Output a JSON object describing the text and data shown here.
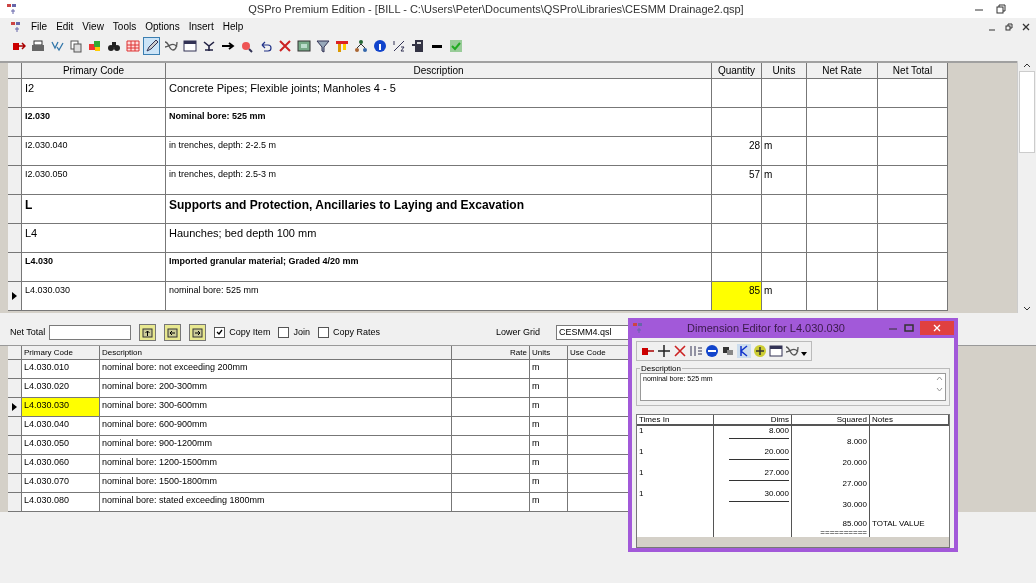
{
  "window": {
    "title": "QSPro Premium Edition - [BILL - C:\\Users\\Peter\\Documents\\QSPro\\Libraries\\CESMM Drainage2.qsp]"
  },
  "menu": [
    "File",
    "Edit",
    "View",
    "Tools",
    "Options",
    "Insert",
    "Help"
  ],
  "toolbar_buttons": [
    {
      "pressed": false
    },
    {
      "pressed": false
    },
    {
      "pressed": false
    },
    {
      "pressed": false
    },
    {
      "pressed": false
    },
    {
      "pressed": false
    },
    {
      "pressed": false
    },
    {
      "pressed": true
    },
    {
      "pressed": false
    },
    {
      "pressed": false
    },
    {
      "pressed": false
    },
    {
      "pressed": false
    },
    {
      "pressed": false
    },
    {
      "pressed": false
    },
    {
      "pressed": false
    },
    {
      "pressed": false
    },
    {
      "pressed": false
    },
    {
      "pressed": false
    },
    {
      "pressed": false
    },
    {
      "pressed": false
    },
    {
      "pressed": false
    },
    {
      "pressed": false
    },
    {
      "pressed": false
    },
    {
      "pressed": false
    }
  ],
  "upper_grid": {
    "columns": [
      "Primary Code",
      "Description",
      "Quantity",
      "Units",
      "Net Rate",
      "Net Total"
    ],
    "rows": [
      {
        "kind": "class",
        "code": "I2",
        "description": "Concrete Pipes; Flexible joints; Manholes 4 - 5",
        "quantity": "",
        "units": "",
        "selected": false
      },
      {
        "kind": "group",
        "code": "I2.030",
        "description": "Nominal bore: 525 mm",
        "quantity": "",
        "units": "",
        "selected": false
      },
      {
        "kind": "item",
        "code": "I2.030.040",
        "description": "in trenches, depth: 2-2.5 m",
        "quantity": "28",
        "units": "m",
        "selected": false
      },
      {
        "kind": "item",
        "code": "I2.030.050",
        "description": "in trenches, depth: 2.5-3 m",
        "quantity": "57",
        "units": "m",
        "selected": false
      },
      {
        "kind": "chapter",
        "code": "L",
        "description": "Supports and Protection, Ancillaries to Laying and Excavation",
        "quantity": "",
        "units": "",
        "selected": false
      },
      {
        "kind": "class",
        "code": "L4",
        "description": "Haunches; bed depth 100 mm",
        "quantity": "",
        "units": "",
        "selected": false
      },
      {
        "kind": "group",
        "code": "L4.030",
        "description": "Imported granular material; Graded 4/20 mm",
        "quantity": "",
        "units": "",
        "selected": false
      },
      {
        "kind": "item",
        "code": "L4.030.030",
        "description": "nominal bore: 525 mm",
        "quantity": "85",
        "units": "m",
        "selected": true
      }
    ]
  },
  "lower_bar": {
    "net_total_label": "Net Total",
    "checks": [
      {
        "label": "Copy Item",
        "checked": true
      },
      {
        "label": "Join",
        "checked": false
      },
      {
        "label": "Copy Rates",
        "checked": false
      }
    ],
    "lower_grid_label": "Lower Grid",
    "lower_grid": "CESMM4.qsl"
  },
  "lower_grid": {
    "columns": [
      "Primary Code",
      "Description",
      "Rate",
      "Units",
      "Use Code"
    ],
    "rows": [
      {
        "code": "L4.030.010",
        "description": "nominal bore: not exceeding 200mm",
        "units": "m",
        "selected": false
      },
      {
        "code": "L4.030.020",
        "description": "nominal bore: 200-300mm",
        "units": "m",
        "selected": false
      },
      {
        "code": "L4.030.030",
        "description": "nominal bore: 300-600mm",
        "units": "m",
        "selected": true
      },
      {
        "code": "L4.030.040",
        "description": "nominal bore: 600-900mm",
        "units": "m",
        "selected": false
      },
      {
        "code": "L4.030.050",
        "description": "nominal bore: 900-1200mm",
        "units": "m",
        "selected": false
      },
      {
        "code": "L4.030.060",
        "description": "nominal bore: 1200-1500mm",
        "units": "m",
        "selected": false
      },
      {
        "code": "L4.030.070",
        "description": "nominal bore: 1500-1800mm",
        "units": "m",
        "selected": false
      },
      {
        "code": "L4.030.080",
        "description": "nominal bore: stated exceeding 1800mm",
        "units": "m",
        "selected": false
      }
    ]
  },
  "dimension_editor": {
    "title": "Dimension Editor for L4.030.030",
    "description_label": "Description",
    "description": "nominal bore: 525 mm",
    "columns": [
      "Times In",
      "Dims",
      "Squared",
      "Notes"
    ],
    "entries": [
      {
        "times": "1",
        "dim": "8.000",
        "squared": "8.000"
      },
      {
        "times": "1",
        "dim": "20.000",
        "squared": "20.000"
      },
      {
        "times": "1",
        "dim": "27.000",
        "squared": "27.000"
      },
      {
        "times": "1",
        "dim": "30.000",
        "squared": "30.000"
      }
    ],
    "total": {
      "squared": "85.000",
      "note": "TOTAL VALUE",
      "rule": "=========="
    }
  }
}
